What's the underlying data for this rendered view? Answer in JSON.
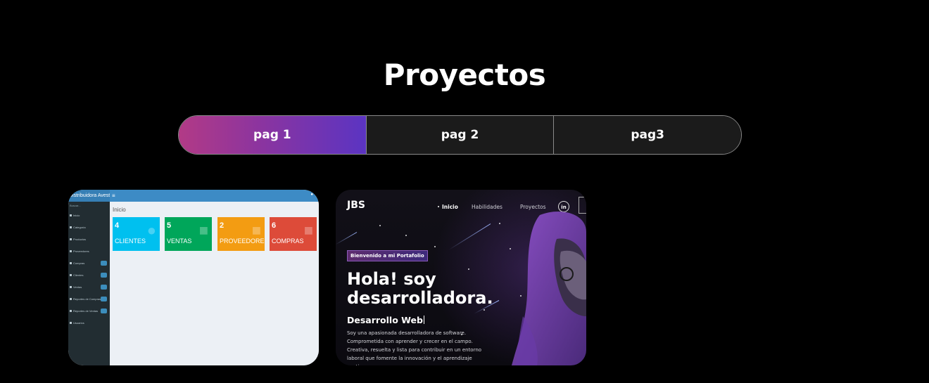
{
  "section": {
    "title": "Proyectos"
  },
  "tabs": [
    {
      "label": "pag 1",
      "active": true
    },
    {
      "label": "pag 2",
      "active": false
    },
    {
      "label": "pag3",
      "active": false
    }
  ],
  "cards": [
    {
      "kind": "admin-dashboard-preview",
      "brand": "Distribuidora Avestria del Pollo",
      "heading": "Inicio",
      "search": "Buscar...",
      "sidebar": [
        "Inicio",
        "Categoría",
        "Productos",
        "Proveedores",
        "Compras",
        "Clientes",
        "Ventas",
        "Reportes de Compras",
        "Reportes de Ventas",
        "Usuarios"
      ],
      "stats": [
        {
          "value": "4",
          "label": "CLIENTES",
          "color": "#00c0ef"
        },
        {
          "value": "5",
          "label": "VENTAS",
          "color": "#00a65a"
        },
        {
          "value": "2",
          "label": "PROVEEDORES",
          "color": "#f39c12"
        },
        {
          "value": "6",
          "label": "COMPRAS",
          "color": "#dd4b39"
        }
      ]
    },
    {
      "kind": "portfolio-preview",
      "logo": "JBS",
      "nav": [
        "Inicio",
        "Habilidades",
        "Proyectos"
      ],
      "social": "in",
      "badge": "Bienvenido a mi Portafolio",
      "headline_1": "Hola! soy",
      "headline_2": "desarrolladora.",
      "subtitle": "Desarrollo Web",
      "description": "Soy una apasionada desarrolladora de software. Comprometida con aprender y crecer en el campo. Creativa, resuelta y lista para contribuir en un entorno laboral que fomente la innovación y el aprendizaje continuo."
    }
  ],
  "colors": {
    "background": "#000000",
    "tab_gradient": [
      "#b23a86",
      "#5b34c2"
    ],
    "tab_inactive": "#1b1b1b"
  }
}
